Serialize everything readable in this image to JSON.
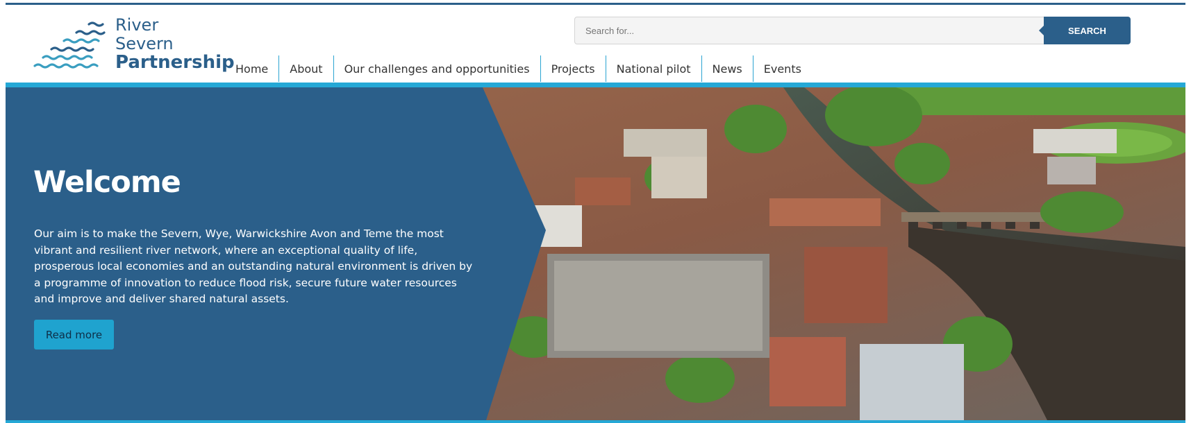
{
  "logo": {
    "line1": "River",
    "line2": "Severn",
    "line3": "Partnership"
  },
  "search": {
    "placeholder": "Search for...",
    "button_label": "SEARCH"
  },
  "nav": {
    "items": [
      {
        "label": "Home"
      },
      {
        "label": "About"
      },
      {
        "label": "Our challenges and opportunities"
      },
      {
        "label": "Projects"
      },
      {
        "label": "National pilot"
      },
      {
        "label": "News"
      },
      {
        "label": "Events"
      }
    ]
  },
  "hero": {
    "title": "Welcome",
    "text": "Our aim is to make the Severn, Wye, Warwickshire Avon and Teme the most vibrant and resilient river network, where an exceptional quality of life, prosperous local economies and an outstanding natural environment is driven by a programme of innovation to reduce flood risk, secure future water resources and improve and deliver shared natural assets.",
    "button_label": "Read more"
  },
  "colors": {
    "brand": "#2b5f8a",
    "accent": "#25a8d6",
    "button": "#1fa3cf"
  }
}
